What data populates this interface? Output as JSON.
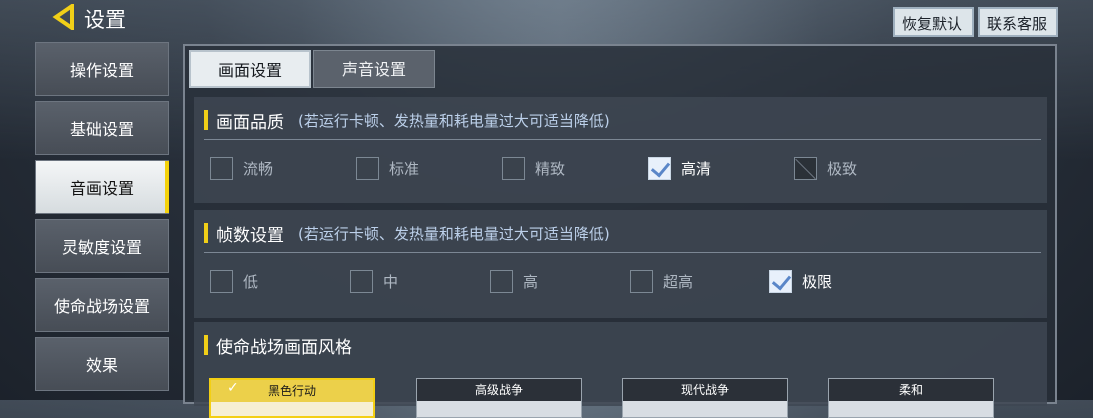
{
  "header": {
    "title": "设置",
    "restore_label": "恢复默认",
    "support_label": "联系客服"
  },
  "sidebar": {
    "items": [
      {
        "label": "操作设置",
        "active": false
      },
      {
        "label": "基础设置",
        "active": false
      },
      {
        "label": "音画设置",
        "active": true
      },
      {
        "label": "灵敏度设置",
        "active": false
      },
      {
        "label": "使命战场设置",
        "active": false
      },
      {
        "label": "效果",
        "active": false
      }
    ]
  },
  "tabs": [
    {
      "label": "画面设置",
      "active": true
    },
    {
      "label": "声音设置",
      "active": false
    }
  ],
  "quality": {
    "title": "画面品质",
    "note": "(若运行卡顿、发热量和耗电量过大可适当降低)",
    "options": [
      {
        "label": "流畅",
        "state": "unchecked"
      },
      {
        "label": "标准",
        "state": "unchecked"
      },
      {
        "label": "精致",
        "state": "unchecked"
      },
      {
        "label": "高清",
        "state": "checked"
      },
      {
        "label": "极致",
        "state": "disabled"
      }
    ]
  },
  "fps": {
    "title": "帧数设置",
    "note": "(若运行卡顿、发热量和耗电量过大可适当降低)",
    "options": [
      {
        "label": "低",
        "state": "unchecked"
      },
      {
        "label": "中",
        "state": "unchecked"
      },
      {
        "label": "高",
        "state": "unchecked"
      },
      {
        "label": "超高",
        "state": "unchecked"
      },
      {
        "label": "极限",
        "state": "checked"
      }
    ]
  },
  "style": {
    "title": "使命战场画面风格",
    "cards": [
      {
        "label": "黑色行动",
        "selected": true
      },
      {
        "label": "高级战争",
        "selected": false
      },
      {
        "label": "现代战争",
        "selected": false
      },
      {
        "label": "柔和",
        "selected": false
      }
    ]
  },
  "colors": {
    "accent": "#f1cf18",
    "check": "#5a86c8"
  }
}
